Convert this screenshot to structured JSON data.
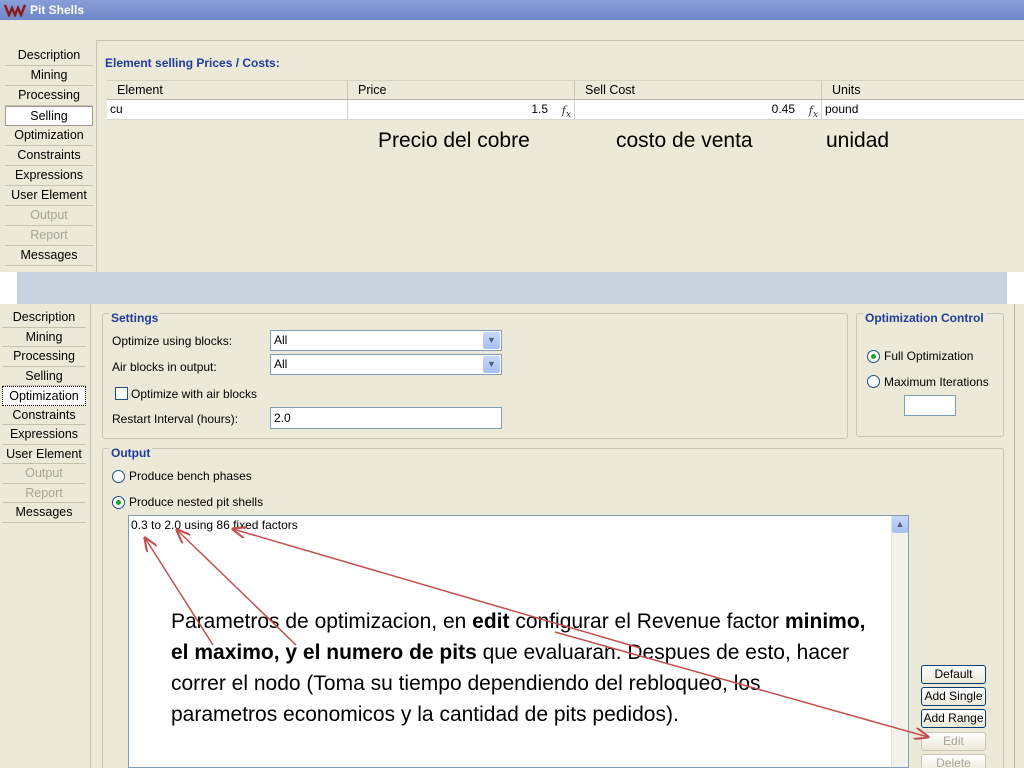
{
  "top_window": {
    "title": "Pit Shells",
    "nav": [
      {
        "label": "Description",
        "state": "normal"
      },
      {
        "label": "Mining",
        "state": "normal"
      },
      {
        "label": "Processing",
        "state": "normal"
      },
      {
        "label": "Selling",
        "state": "selected"
      },
      {
        "label": "Optimization",
        "state": "normal"
      },
      {
        "label": "Constraints",
        "state": "normal"
      },
      {
        "label": "Expressions",
        "state": "normal"
      },
      {
        "label": "User Element",
        "state": "normal"
      },
      {
        "label": "Output",
        "state": "disabled"
      },
      {
        "label": "Report",
        "state": "disabled"
      },
      {
        "label": "Messages",
        "state": "normal"
      }
    ],
    "section_title": "Element selling Prices / Costs:",
    "table": {
      "columns": [
        "Element",
        "Price",
        "Sell Cost",
        "Units"
      ],
      "rows": [
        {
          "element": "cu",
          "price": "1.5",
          "sell_cost": "0.45",
          "units": "pound"
        }
      ]
    },
    "annotations": {
      "price": "Precio del cobre",
      "sell_cost": "costo de venta",
      "units": "unidad"
    }
  },
  "bottom_window": {
    "nav": [
      {
        "label": "Description",
        "state": "normal"
      },
      {
        "label": "Mining",
        "state": "normal"
      },
      {
        "label": "Processing",
        "state": "normal"
      },
      {
        "label": "Selling",
        "state": "normal"
      },
      {
        "label": "Optimization",
        "state": "selected"
      },
      {
        "label": "Constraints",
        "state": "normal"
      },
      {
        "label": "Expressions",
        "state": "normal"
      },
      {
        "label": "User Element",
        "state": "normal"
      },
      {
        "label": "Output",
        "state": "disabled"
      },
      {
        "label": "Report",
        "state": "disabled"
      },
      {
        "label": "Messages",
        "state": "normal"
      }
    ],
    "settings": {
      "title": "Settings",
      "optimize_using_blocks_label": "Optimize using blocks:",
      "optimize_using_blocks_value": "All",
      "air_blocks_label": "Air blocks in output:",
      "air_blocks_value": "All",
      "optimize_with_air_label": "Optimize with air blocks",
      "optimize_with_air_checked": false,
      "restart_interval_label": "Restart Interval (hours):",
      "restart_interval_value": "2.0"
    },
    "optimization_control": {
      "title": "Optimization Control",
      "full_label": "Full Optimization",
      "max_iter_label": "Maximum Iterations",
      "selected": "full",
      "max_iter_value": ""
    },
    "output": {
      "title": "Output",
      "bench_label": "Produce bench phases",
      "nested_label": "Produce nested pit shells",
      "selected": "nested",
      "factors_line": "0.3 to 2.0 using 86 fixed factors"
    },
    "buttons": {
      "default": "Default",
      "add_single": "Add Single",
      "add_range": "Add Range",
      "edit": "Edit",
      "delete": "Delete"
    },
    "annotation": {
      "p1": "Parametros de optimizacion, en ",
      "b1": "edit",
      "p2": " configurar el Revenue factor ",
      "b2": "minimo, el maximo, y el numero de pits",
      "p3": " que evaluaran. Despues de esto, hacer correr el nodo (Toma su tiempo dependiendo del rebloqueo, los parametros economicos y la cantidad de pits pedidos)."
    }
  },
  "colors": {
    "panel": "#ece9d8",
    "group_title": "#1f3d9c",
    "titlebar": "#7a90cd",
    "arrow": "#c0504d"
  }
}
